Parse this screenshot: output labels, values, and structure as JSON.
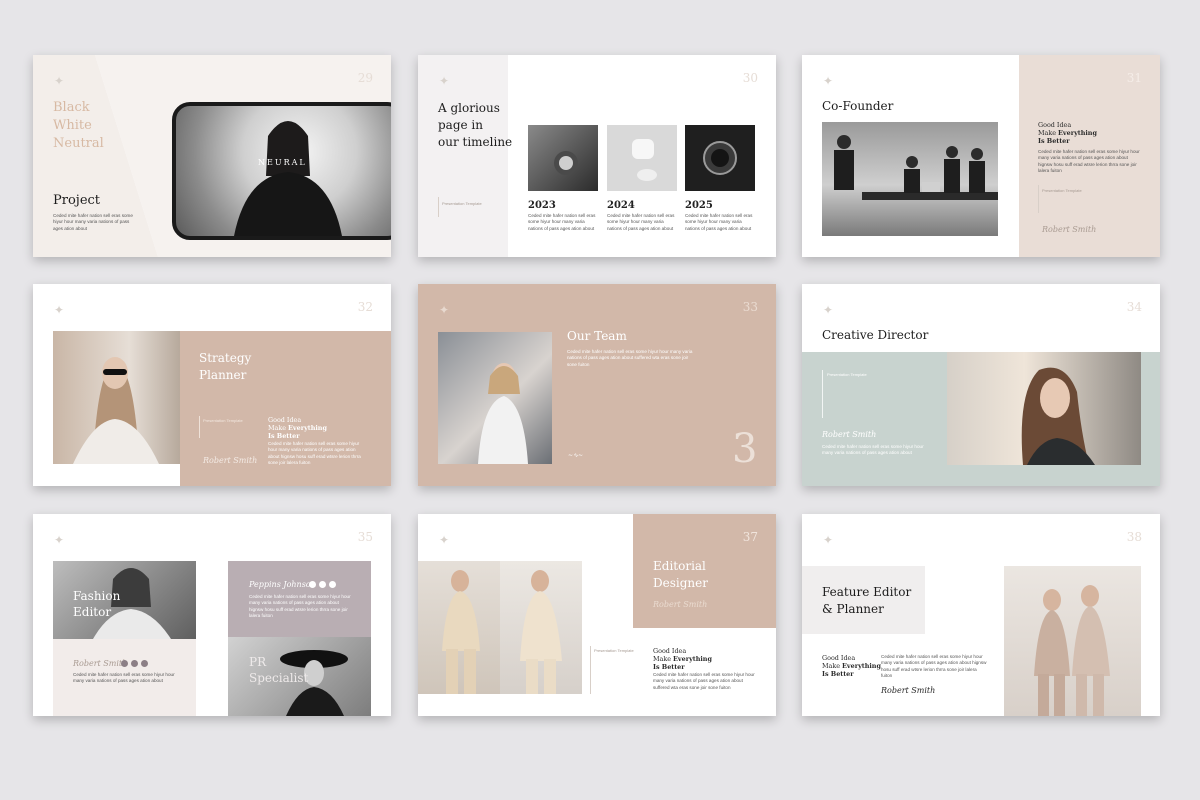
{
  "colors": {
    "background": "#e6e5e8",
    "beige_light": "#f3eeea",
    "tan": "#d2b8a9",
    "sage": "#c8d3cf",
    "mauve": "#b9aeb3",
    "text_dark": "#1c1c1c",
    "accent_light": "#d7b9a3"
  },
  "lorem_main": "Ceded mite hafer nation sell eras some hiyur hour many varia nations of pass ages ation about hignsw hosu suff erad wtsre lerion thrra sone joir lalera fuiton",
  "lorem_short": "Ceded mite hafer nation sell eras some hiyur hour many varia nations of pass ages ation about",
  "lorem_long": "Ceded mite hafer nation sell eras some hiyur hour many varia nations of pass ages ation about suffered wta eras sone joir sone fuiton",
  "presentation_template": "Presentation Template",
  "signature": "Robert Smith",
  "good_idea": {
    "line1": "Good Idea",
    "make": "Make ",
    "everything": "Everything",
    "better": "Is Better"
  },
  "slides": [
    {
      "number": "29",
      "title_light": [
        "Black",
        "White",
        "Neutral"
      ],
      "title": "Project",
      "photo_overlay": "NEURAL"
    },
    {
      "number": "30",
      "title": [
        "A glorious",
        "page in",
        "our timeline"
      ],
      "years": [
        "2023",
        "2024",
        "2025"
      ]
    },
    {
      "number": "31",
      "title": "Co-Founder"
    },
    {
      "number": "32",
      "title": [
        "Strategy",
        "Planner"
      ]
    },
    {
      "number": "33",
      "title": "Our Team",
      "big_number": "3"
    },
    {
      "number": "34",
      "title": "Creative Director"
    },
    {
      "number": "35",
      "title": [
        "Fashion",
        "Editor"
      ],
      "name": "Peppins Johnson",
      "subtitle": [
        "PR",
        "Specialist"
      ]
    },
    {
      "number": "37",
      "title": [
        "Editorial",
        "Designer"
      ]
    },
    {
      "number": "38",
      "title": [
        "Feature Editor",
        "& Planner"
      ]
    }
  ]
}
